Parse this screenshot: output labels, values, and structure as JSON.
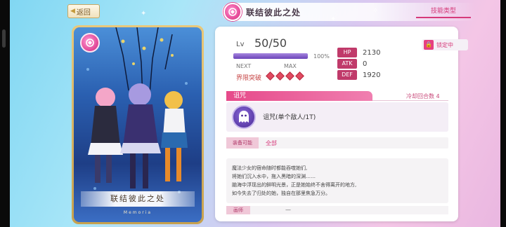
{
  "header": {
    "back_label": "返回",
    "title": "联结彼此之处",
    "skill_type_button": "技能类型"
  },
  "card": {
    "name": "联结彼此之处",
    "subtitle": "Memoria"
  },
  "lock": {
    "label": "锁定中"
  },
  "level": {
    "label": "Lv",
    "value": "50/50",
    "percent": "100%",
    "progress": 1.0,
    "next_label": "NEXT",
    "max_label": "MAX"
  },
  "limit_break": {
    "label": "界限突破",
    "count": 4
  },
  "stats": [
    {
      "key": "HP",
      "value": "2130"
    },
    {
      "key": "ATK",
      "value": "0"
    },
    {
      "key": "DEF",
      "value": "1920"
    }
  ],
  "skill": {
    "tab_label": "诅咒",
    "cooldown": "冷却回合数 4",
    "name": "诅咒(单个敌人/1T)"
  },
  "equip": {
    "key": "装备可能",
    "value": "全部"
  },
  "description": [
    "魔法少女的宿命随时都能吞噬她们,",
    "将她们沉入水中，拖入黑暗的深渊……",
    "脑海中浮现出的鲜明光景，正是她始终不舍得离开的地方,",
    "如今失去了归处的她，独自在那里焦急万分。"
  ],
  "artist": {
    "key": "画师",
    "value": "—"
  },
  "colors": {
    "accent": "#d63a7a",
    "stat_key": "#c03a6a",
    "bar_fill": "#6a44b8"
  }
}
